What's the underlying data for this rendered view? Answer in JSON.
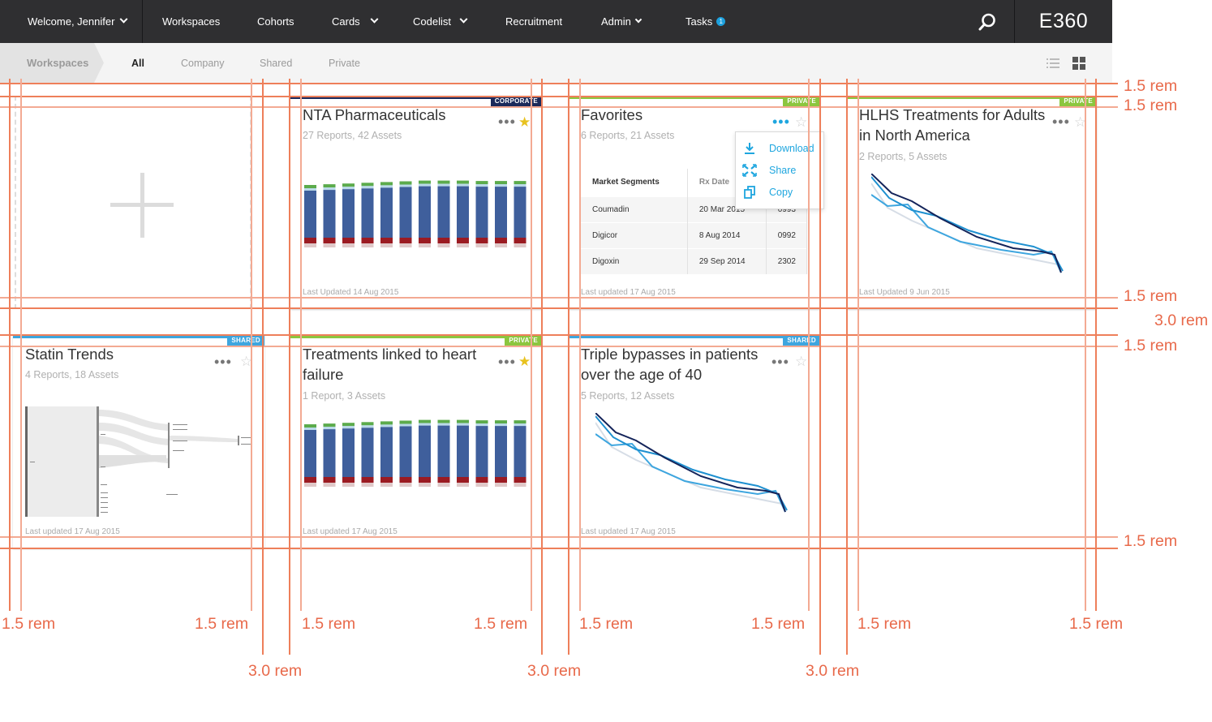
{
  "nav": {
    "welcome": "Welcome, Jennifer",
    "items": [
      {
        "label": "Workspaces"
      },
      {
        "label": "Cohorts"
      },
      {
        "label": "Cards"
      },
      {
        "label": "Codelist"
      },
      {
        "label": "Recruitment"
      },
      {
        "label": "Admin"
      },
      {
        "label": "Tasks",
        "badge": "1"
      }
    ],
    "brand": "E360"
  },
  "subnav": {
    "breadcrumb": "Workspaces",
    "filters": [
      "All",
      "Company",
      "Shared",
      "Private"
    ],
    "active_filter": "All"
  },
  "cards": [
    {
      "title": "NTA Pharmaceuticals",
      "meta": "27 Reports, 42 Assets",
      "tag": "CORPORATE",
      "updated": "Last Updated  14 Aug 2015",
      "starred": true,
      "tag_color": "#1b2a5b"
    },
    {
      "title": "Favorites",
      "meta": "6 Reports, 21 Assets",
      "tag": "PRIVATE",
      "updated": "Last updated 17 Aug 2015",
      "starred": false,
      "tag_color": "#8cc63f"
    },
    {
      "title": "HLHS Treatments for Adults in North America",
      "meta": "2 Reports, 5 Assets",
      "tag": "PRIVATE",
      "updated": "Last Updated  9 Jun 2015",
      "starred": false,
      "tag_color": "#8cc63f"
    },
    {
      "title": "Statin Trends",
      "meta": "4 Reports, 18 Assets",
      "tag": "SHARED",
      "updated": "Last updated 17 Aug 2015",
      "starred": false,
      "tag_color": "#3ea6df"
    },
    {
      "title": "Treatments linked to heart failure",
      "meta": "1 Report, 3 Assets",
      "tag": "PRIVATE",
      "updated": "Last updated 17 Aug 2015",
      "starred": true,
      "tag_color": "#8cc63f"
    },
    {
      "title": "Triple bypasses in patients over the age of 40",
      "meta": "5 Reports, 12 Assets",
      "tag": "SHARED",
      "updated": "Last updated 17 Aug 2015",
      "starred": false,
      "tag_color": "#3ea6df"
    }
  ],
  "favorites_table": {
    "headers": [
      "Market Segments",
      "Rx Date",
      ""
    ],
    "rows": [
      [
        "Coumadin",
        "20 Mar 2015",
        "0993"
      ],
      [
        "Digicor",
        "8 Aug 2014",
        "0992"
      ],
      [
        "Digoxin",
        "29 Sep 2014",
        "2302"
      ]
    ]
  },
  "card_menu": {
    "items": [
      {
        "label": "Download",
        "icon": "download-icon"
      },
      {
        "label": "Share",
        "icon": "share-icon"
      },
      {
        "label": "Copy",
        "icon": "copy-icon"
      }
    ]
  },
  "spec_labels": {
    "right": [
      "1.5 rem",
      "1.5 rem",
      "1.5 rem",
      "3.0 rem",
      "1.5 rem",
      "1.5 rem"
    ],
    "bottom_pad": [
      "1.5 rem",
      "1.5 rem",
      "1.5 rem",
      "1.5 rem",
      "1.5 rem",
      "1.5 rem",
      "1.5 rem",
      "1.5 rem"
    ],
    "gutters": [
      "3.0 rem",
      "3.0 rem",
      "3.0 rem"
    ]
  },
  "colors": {
    "nav_bg": "#2f2f31",
    "accent": "#1da1de",
    "corporate": "#1b2a5b",
    "private": "#8cc63f",
    "shared": "#3ea6df",
    "spec_red": "#ee7f5a",
    "star_gold": "#e8c21f"
  },
  "chart_data": [
    {
      "type": "bar",
      "title": "",
      "stacked": true,
      "series_count": 4
    },
    {
      "type": "line",
      "title": "",
      "series_count": 4
    }
  ]
}
